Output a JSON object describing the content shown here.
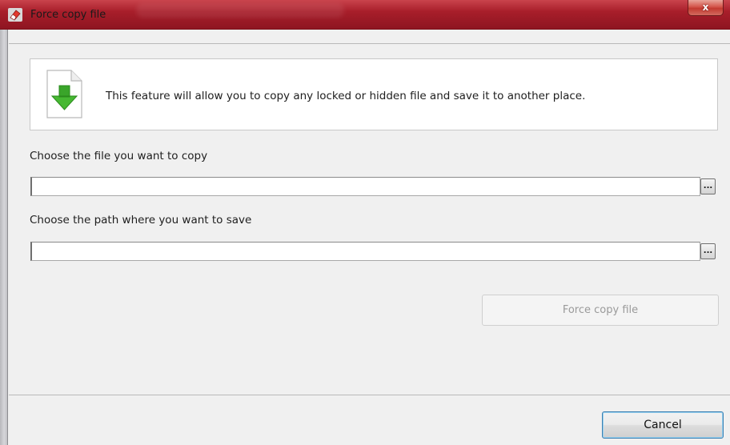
{
  "window": {
    "title": "Force copy file",
    "close_glyph": "x",
    "app_icon": "eraser-icon",
    "title_bar_color": "#a81e2a"
  },
  "info": {
    "icon": "file-download-icon",
    "icon_accent": "#3aa52a",
    "text": "This feature will allow you to copy any locked or hidden file and save it to another place."
  },
  "source": {
    "label": "Choose the file you want to copy",
    "value": "",
    "browse_label": "..."
  },
  "destination": {
    "label": "Choose the path where you want to save",
    "value": "",
    "browse_label": "..."
  },
  "actions": {
    "force_copy_label": "Force copy file",
    "force_copy_enabled": false,
    "cancel_label": "Cancel"
  }
}
